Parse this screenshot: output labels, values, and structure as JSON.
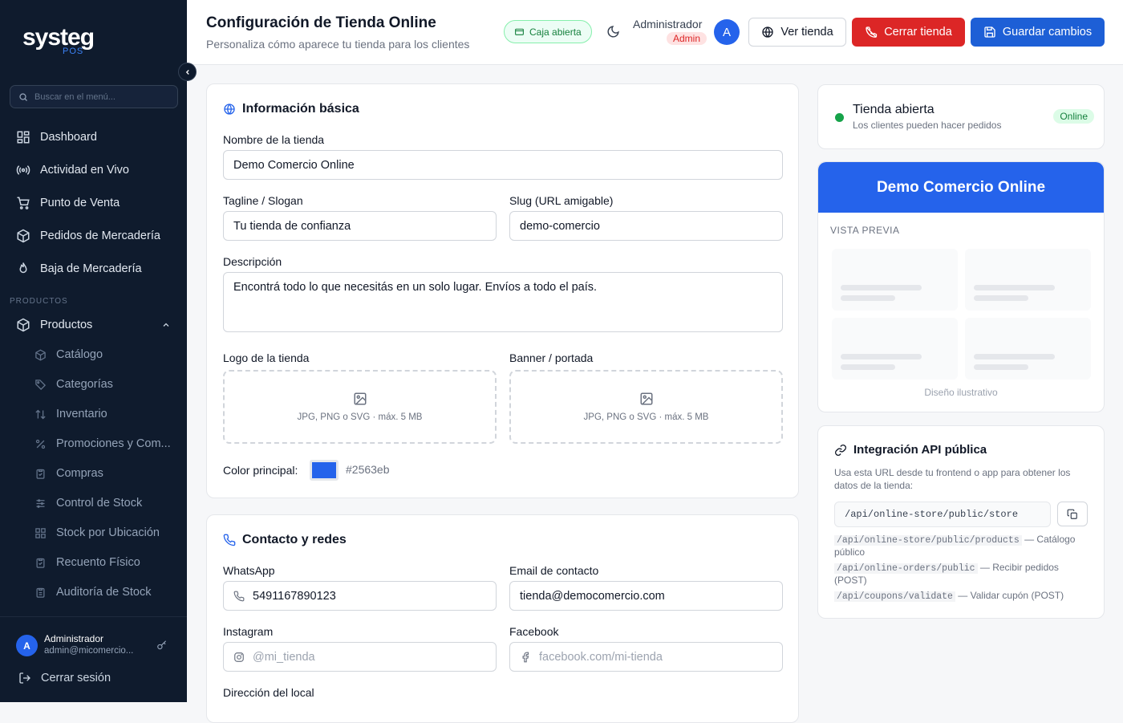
{
  "sidebar": {
    "logo": "systeg",
    "logo_sub": "POS",
    "search_placeholder": "Buscar en el menú...",
    "items": [
      {
        "label": "Dashboard"
      },
      {
        "label": "Actividad en Vivo"
      },
      {
        "label": "Punto de Venta"
      },
      {
        "label": "Pedidos de Mercadería"
      },
      {
        "label": "Baja de Mercadería"
      }
    ],
    "section_label": "PRODUCTOS",
    "products_label": "Productos",
    "sub_items": [
      {
        "label": "Catálogo"
      },
      {
        "label": "Categorías"
      },
      {
        "label": "Inventario"
      },
      {
        "label": "Promociones y Com..."
      },
      {
        "label": "Compras"
      },
      {
        "label": "Control de Stock"
      },
      {
        "label": "Stock por Ubicación"
      },
      {
        "label": "Recuento Físico"
      },
      {
        "label": "Auditoría de Stock"
      }
    ],
    "user": {
      "avatar": "A",
      "name": "Administrador",
      "email": "admin@micomercio..."
    },
    "logout_label": "Cerrar sesión"
  },
  "header": {
    "title": "Configuración de Tienda Online",
    "subtitle": "Personaliza cómo aparece tu tienda para los clientes",
    "caja_label": "Caja abierta",
    "admin_name": "Administrador",
    "admin_role": "Admin",
    "avatar": "A",
    "btn_ver": "Ver tienda",
    "btn_cerrar": "Cerrar tienda",
    "btn_guardar": "Guardar cambios"
  },
  "basic": {
    "title": "Información básica",
    "name_label": "Nombre de la tienda",
    "name_value": "Demo Comercio Online",
    "tagline_label": "Tagline / Slogan",
    "tagline_value": "Tu tienda de confianza",
    "slug_label": "Slug (URL amigable)",
    "slug_value": "demo-comercio",
    "desc_label": "Descripción",
    "desc_value": "Encontrá todo lo que necesitás en un solo lugar. Envíos a todo el país.",
    "logo_label": "Logo de la tienda",
    "banner_label": "Banner / portada",
    "upload_hint": "JPG, PNG o SVG · máx. 5 MB",
    "color_label": "Color principal:",
    "color_value": "#2563eb"
  },
  "contact": {
    "title": "Contacto y redes",
    "whatsapp_label": "WhatsApp",
    "whatsapp_value": "5491167890123",
    "email_label": "Email de contacto",
    "email_value": "tienda@democomercio.com",
    "instagram_label": "Instagram",
    "instagram_placeholder": "@mi_tienda",
    "facebook_label": "Facebook",
    "facebook_placeholder": "facebook.com/mi-tienda",
    "address_label": "Dirección del local"
  },
  "status": {
    "title": "Tienda abierta",
    "subtitle": "Los clientes pueden hacer pedidos",
    "badge": "Online",
    "dot_color": "#16a34a"
  },
  "preview": {
    "store_name": "Demo Comercio Online",
    "label": "VISTA PREVIA",
    "footer": "Diseño ilustrativo"
  },
  "api": {
    "title": "Integración API pública",
    "description": "Usa esta URL desde tu frontend o app para obtener los datos de la tienda:",
    "url": "/api/online-store/public/store",
    "endpoints": [
      {
        "path": "/api/online-store/public/products",
        "desc": "— Catálogo público"
      },
      {
        "path": "/api/online-orders/public",
        "desc": "— Recibir pedidos (POST)"
      },
      {
        "path": "/api/coupons/validate",
        "desc": "— Validar cupón (POST)"
      }
    ]
  }
}
